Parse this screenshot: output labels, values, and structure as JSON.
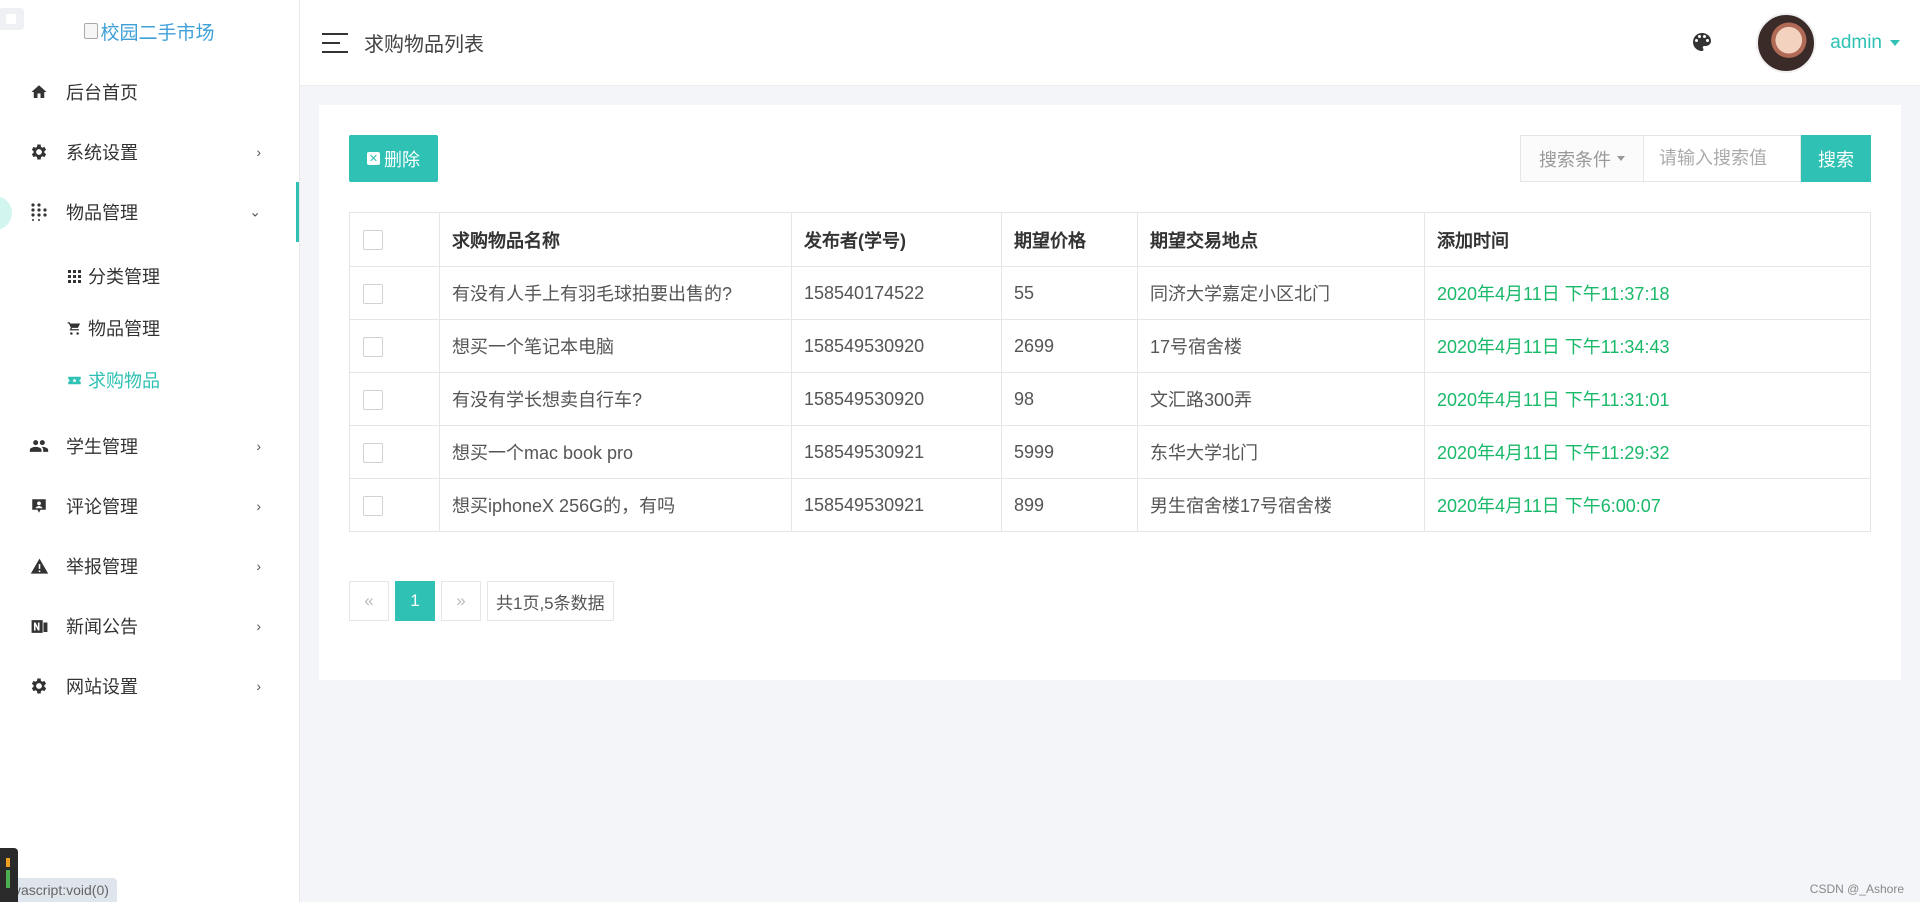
{
  "logo": {
    "alt_text": "校园二手市场"
  },
  "sidebar": {
    "items": [
      {
        "label": "后台首页",
        "icon": "home-icon",
        "has_arrow": false
      },
      {
        "label": "系统设置",
        "icon": "gear-icon",
        "has_arrow": true
      },
      {
        "label": "物品管理",
        "icon": "apps-icon",
        "has_arrow": true,
        "open": true,
        "children": [
          {
            "label": "分类管理",
            "icon": "grid-icon",
            "active": false
          },
          {
            "label": "物品管理",
            "icon": "cart-icon",
            "active": false
          },
          {
            "label": "求购物品",
            "icon": "ticket-icon",
            "active": true
          }
        ]
      },
      {
        "label": "学生管理",
        "icon": "people-icon",
        "has_arrow": true
      },
      {
        "label": "评论管理",
        "icon": "comment-user-icon",
        "has_arrow": true
      },
      {
        "label": "举报管理",
        "icon": "warning-icon",
        "has_arrow": true
      },
      {
        "label": "新闻公告",
        "icon": "news-icon",
        "has_arrow": true
      },
      {
        "label": "网站设置",
        "icon": "gear-icon",
        "has_arrow": true
      }
    ]
  },
  "header": {
    "title": "求购物品列表",
    "username": "admin"
  },
  "toolbar": {
    "delete_label": "删除",
    "search_condition_label": "搜索条件",
    "search_placeholder": "请输入搜索值",
    "search_button_label": "搜索"
  },
  "table": {
    "headers": [
      "求购物品名称",
      "发布者(学号)",
      "期望价格",
      "期望交易地点",
      "添加时间"
    ],
    "rows": [
      [
        "有没有人手上有羽毛球拍要出售的?",
        "158540174522",
        "55",
        "同济大学嘉定小区北门",
        "2020年4月11日 下午11:37:18"
      ],
      [
        "想买一个笔记本电脑",
        "158549530920",
        "2699",
        "17号宿舍楼",
        "2020年4月11日 下午11:34:43"
      ],
      [
        "有没有学长想卖自行车?",
        "158549530920",
        "98",
        "文汇路300弄",
        "2020年4月11日 下午11:31:01"
      ],
      [
        "想买一个mac book pro",
        "158549530921",
        "5999",
        "东华大学北门",
        "2020年4月11日 下午11:29:32"
      ],
      [
        "想买iphoneX 256G的，有吗",
        "158549530921",
        "899",
        "男生宿舍楼17号宿舍楼",
        "2020年4月11日 下午6:00:07"
      ]
    ]
  },
  "pagination": {
    "prev": "«",
    "current": "1",
    "next": "»",
    "summary": "共1页,5条数据"
  },
  "statusbar": {
    "link": "vascript:void(0)"
  },
  "watermark": "CSDN @_Ashore",
  "colors": {
    "accent": "#2ec1b4",
    "time_green": "#19b96a"
  }
}
